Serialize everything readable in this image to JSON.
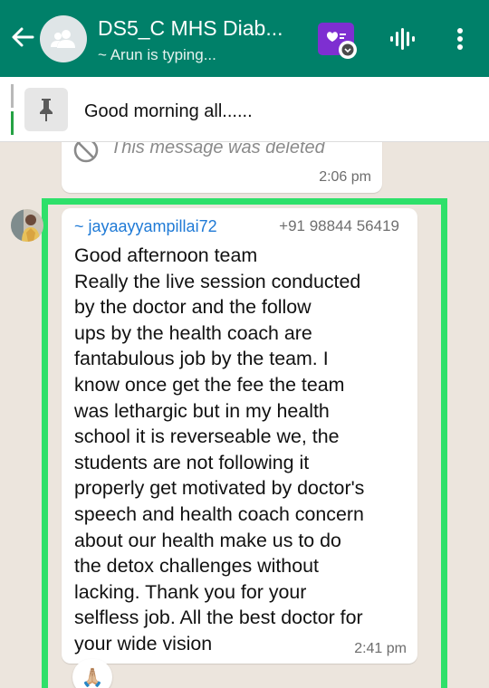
{
  "header": {
    "title": "DS5_C MHS Diab...",
    "subtitle": "~ Arun is typing..."
  },
  "pinned": {
    "text": "Good morning all......"
  },
  "deleted_message": {
    "text": "This message was deleted",
    "time": "2:06 pm"
  },
  "message": {
    "sender_name": "~ jayaayyampillai72",
    "sender_phone": "+91 98844 56419",
    "lines": [
      "Good afternoon team",
      "Really the live session conducted",
      "by the doctor and the follow",
      "ups by the health coach are",
      "fantabulous job by the team. I",
      "know once get the fee the team",
      "was lethargic but in my health",
      "school it is reverseable we,  the",
      "students are not following it",
      "properly get motivated by doctor's",
      "speech and  health coach concern",
      "about our health make us to do",
      "the detox challenges without",
      "lacking. Thank you for your",
      "selfless job. All the best doctor for",
      "your wide vision"
    ],
    "time": "2:41 pm",
    "reaction": "🙏🏼"
  },
  "colors": {
    "header_bg": "#008069",
    "highlight": "#2ee06a",
    "sender_name": "#1f7ad6",
    "chat_bg": "#ece5dd"
  },
  "icons": [
    "back-arrow-icon",
    "group-avatar-icon",
    "app-shortcut-icon",
    "voice-chat-icon",
    "more-options-icon",
    "pin-icon",
    "deleted-icon"
  ]
}
